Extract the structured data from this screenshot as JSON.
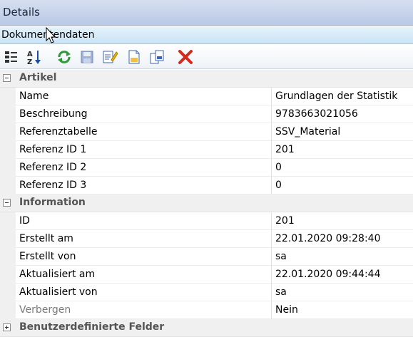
{
  "window": {
    "title": "Details"
  },
  "subheader": {
    "title": "Dokumentendaten"
  },
  "toolbar": {
    "buttons": [
      {
        "icon": "categorized-view-icon"
      },
      {
        "icon": "sort-alphabetical-icon"
      },
      {
        "icon": "refresh-icon"
      },
      {
        "icon": "save-icon"
      },
      {
        "icon": "edit-icon"
      },
      {
        "icon": "new-document-icon"
      },
      {
        "icon": "copy-document-icon"
      },
      {
        "icon": "delete-icon"
      }
    ]
  },
  "sections": [
    {
      "label": "Artikel",
      "rows": [
        {
          "name": "Name",
          "value": "Grundlagen der Statistik"
        },
        {
          "name": "Beschreibung",
          "value": "9783663021056"
        },
        {
          "name": "Referenztabelle",
          "value": "SSV_Material"
        },
        {
          "name": "Referenz ID 1",
          "value": "201"
        },
        {
          "name": "Referenz ID 2",
          "value": "0"
        },
        {
          "name": "Referenz ID 3",
          "value": "0"
        }
      ]
    },
    {
      "label": "Information",
      "rows": [
        {
          "name": "ID",
          "value": "201"
        },
        {
          "name": "Erstellt am",
          "value": "22.01.2020 09:28:40"
        },
        {
          "name": "Erstellt von",
          "value": "sa"
        },
        {
          "name": "Aktualisiert am",
          "value": "22.01.2020 09:44:44"
        },
        {
          "name": "Aktualisiert von",
          "value": "sa"
        },
        {
          "name": "Verbergen",
          "value": "Nein"
        }
      ]
    },
    {
      "label": "Benutzerdefinierte Felder"
    }
  ]
}
